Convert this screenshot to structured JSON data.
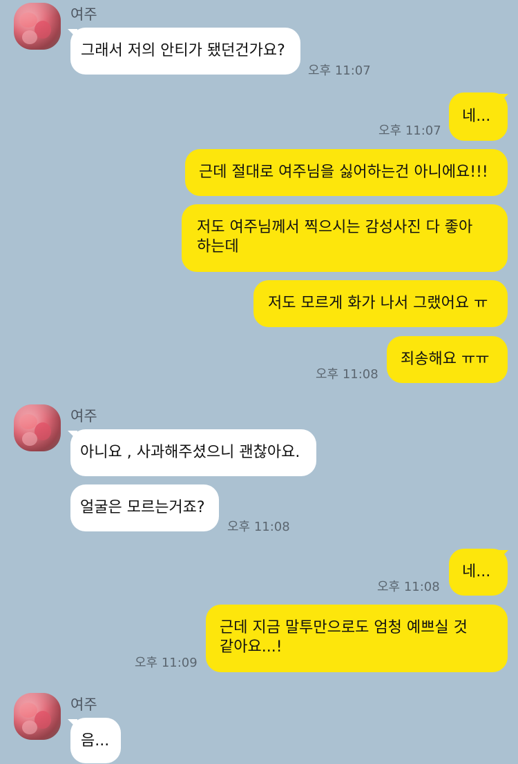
{
  "sender_name": "여주",
  "messages": [
    {
      "dir": "in",
      "text": "그래서 저의 안티가 됐던건가요?",
      "time": "오후 11:07"
    },
    {
      "dir": "out",
      "text": "네...",
      "time": "오후 11:07"
    },
    {
      "dir": "out",
      "text": "근데 절대로 여주님을 싫어하는건 아니에요!!!",
      "time": ""
    },
    {
      "dir": "out",
      "text_line1": "저도 여주님께서 찍으시는 감성사진 다 좋아",
      "text_line2": "하는데",
      "time": ""
    },
    {
      "dir": "out",
      "text": "저도 모르게 화가 나서 그랬어요 ㅠ",
      "time": ""
    },
    {
      "dir": "out",
      "text": "죄송해요 ㅠㅠ",
      "time": "오후 11:08"
    },
    {
      "dir": "in",
      "text": "아니요 , 사과해주셨으니 괜찮아요.",
      "time": ""
    },
    {
      "dir": "in",
      "text": "얼굴은 모르는거죠?",
      "time": "오후 11:08"
    },
    {
      "dir": "out",
      "text": "네...",
      "time": "오후 11:08"
    },
    {
      "dir": "out",
      "text_line1": "근데 지금 말투만으로도 엄청 예쁘실 것",
      "text_line2": "같아요...!",
      "time": "오후 11:09"
    },
    {
      "dir": "in",
      "text": "음...",
      "time": ""
    }
  ],
  "colors": {
    "background": "#abc1d1",
    "incoming_bubble": "#ffffff",
    "outgoing_bubble": "#fde60c"
  },
  "icons": {
    "avatar": "profile-photo-avatar"
  }
}
